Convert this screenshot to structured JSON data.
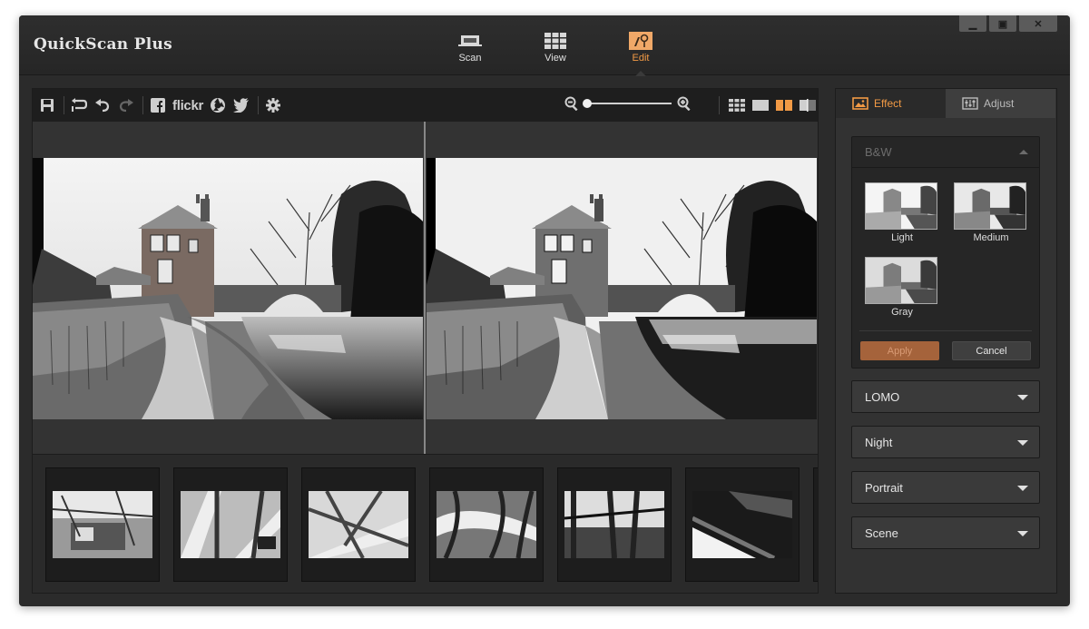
{
  "app": {
    "title": "QuickScan Plus"
  },
  "window_controls": [
    "minimize-icon",
    "maximize-icon",
    "close-icon"
  ],
  "mode_tabs": [
    {
      "label": "Scan",
      "icon": "scanner-icon",
      "active": false
    },
    {
      "label": "View",
      "icon": "grid-icon",
      "active": false
    },
    {
      "label": "Edit",
      "icon": "edit-tools-icon",
      "active": true
    }
  ],
  "toolbar": {
    "icons": [
      "save-icon",
      "revert-icon",
      "undo-icon",
      "redo-icon",
      "facebook-icon",
      "picasa-icon",
      "twitter-icon",
      "settings-icon"
    ],
    "flickr_label": "flickr",
    "zoom": {
      "level": 0.0
    },
    "view_modes": [
      "grid-view-icon",
      "single-view-icon",
      "side-by-side-view-icon",
      "split-view-icon"
    ],
    "active_view": "side-by-side-view-icon"
  },
  "side_tabs": [
    {
      "label": "Effect",
      "icon": "image-icon",
      "active": true
    },
    {
      "label": "Adjust",
      "icon": "sliders-icon",
      "active": false
    }
  ],
  "effects": {
    "bw": {
      "title": "B&W",
      "presets": [
        {
          "label": "Light"
        },
        {
          "label": "Medium"
        },
        {
          "label": "Gray"
        }
      ],
      "apply_label": "Apply",
      "cancel_label": "Cancel"
    },
    "groups": [
      {
        "label": "LOMO"
      },
      {
        "label": "Night"
      },
      {
        "label": "Portrait"
      },
      {
        "label": "Scene"
      }
    ]
  },
  "colors": {
    "accent": "#f29a45",
    "panel": "#323232",
    "toolbar": "#1e1e1e"
  }
}
